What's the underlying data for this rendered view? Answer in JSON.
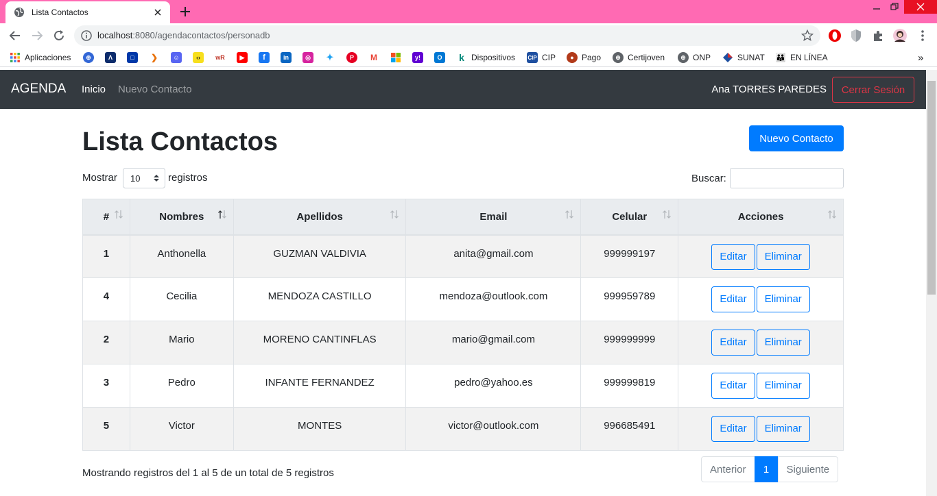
{
  "browser": {
    "tab_title": "Lista Contactos",
    "url_host": "localhost",
    "url_path": ":8080/agendacontactos/personadb",
    "bookmarks": [
      "Aplicaciones",
      "Dispositivos",
      "CIP",
      "Pago",
      "Certijoven",
      "ONP",
      "SUNAT",
      "EN LÍNEA"
    ],
    "overflow_label": "»"
  },
  "app": {
    "brand": "AGENDA",
    "nav": {
      "home": "Inicio",
      "new_contact": "Nuevo Contacto"
    },
    "user_name": "Ana TORRES PAREDES",
    "logout_label": "Cerrar Sesión"
  },
  "page": {
    "title": "Lista Contactos",
    "new_button": "Nuevo Contacto",
    "show_label": "Mostrar",
    "page_size": "10",
    "records_label": "registros",
    "search_label": "Buscar:",
    "info": "Mostrando registros del 1 al 5 de un total de 5 registros"
  },
  "table": {
    "columns": [
      "#",
      "Nombres",
      "Apellidos",
      "Email",
      "Celular",
      "Acciones"
    ],
    "rows": [
      {
        "id": "1",
        "nombres": "Anthonella",
        "apellidos": "GUZMAN VALDIVIA",
        "email": "anita@gmail.com",
        "celular": "999999197"
      },
      {
        "id": "4",
        "nombres": "Cecilia",
        "apellidos": "MENDOZA CASTILLO",
        "email": "mendoza@outlook.com",
        "celular": "999959789"
      },
      {
        "id": "2",
        "nombres": "Mario",
        "apellidos": "MORENO CANTINFLAS",
        "email": "mario@gmail.com",
        "celular": "999999999"
      },
      {
        "id": "3",
        "nombres": "Pedro",
        "apellidos": "INFANTE FERNANDEZ",
        "email": "pedro@yahoo.es",
        "celular": "999999819"
      },
      {
        "id": "5",
        "nombres": "Victor",
        "apellidos": "MONTES",
        "email": "victor@outlook.com",
        "celular": "996685491"
      }
    ],
    "edit_label": "Editar",
    "delete_label": "Eliminar"
  },
  "pagination": {
    "prev": "Anterior",
    "current": "1",
    "next": "Siguiente"
  },
  "colors": {
    "tabbar": "#ff6ab3",
    "navbar": "#343a40",
    "primary": "#007bff",
    "danger": "#dc3545"
  }
}
